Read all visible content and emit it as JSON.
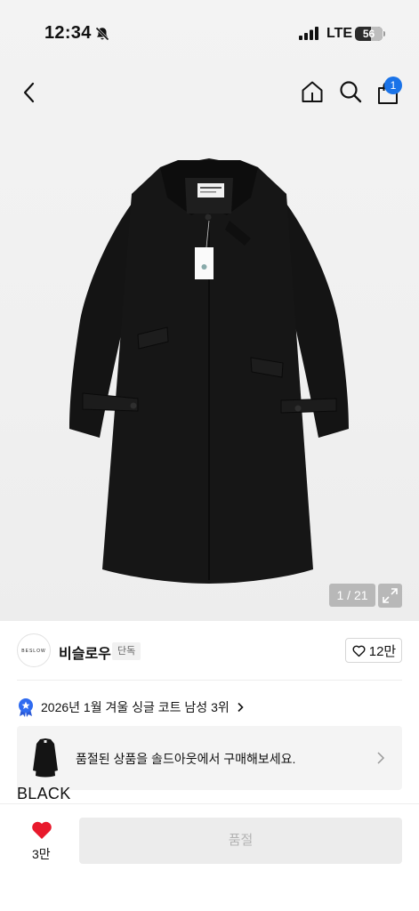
{
  "status_bar": {
    "time": "12:34",
    "network": "LTE",
    "battery": "56"
  },
  "header": {
    "cart_count": "1",
    "icons": [
      "back-icon",
      "home-icon",
      "search-icon",
      "shopping-bag-icon"
    ]
  },
  "gallery": {
    "counter": "1 / 21",
    "current": 1,
    "total": 21
  },
  "brand": {
    "logo_text": "BESLOW",
    "name": "비슬로우",
    "tag": "단독",
    "likes": "12만"
  },
  "ranking": {
    "text": "2026년 1월 겨울 싱글 코트 남성 3위"
  },
  "soldout_banner": {
    "text": "품절된 상품을 솔드아웃에서 구매해보세요."
  },
  "product": {
    "color": "BLACK"
  },
  "bottom_bar": {
    "likes": "3만",
    "buy_label": "품절"
  },
  "colors": {
    "accent": "#1a73e8",
    "heart": "#e8192c",
    "disabled_button": "#ececec"
  }
}
